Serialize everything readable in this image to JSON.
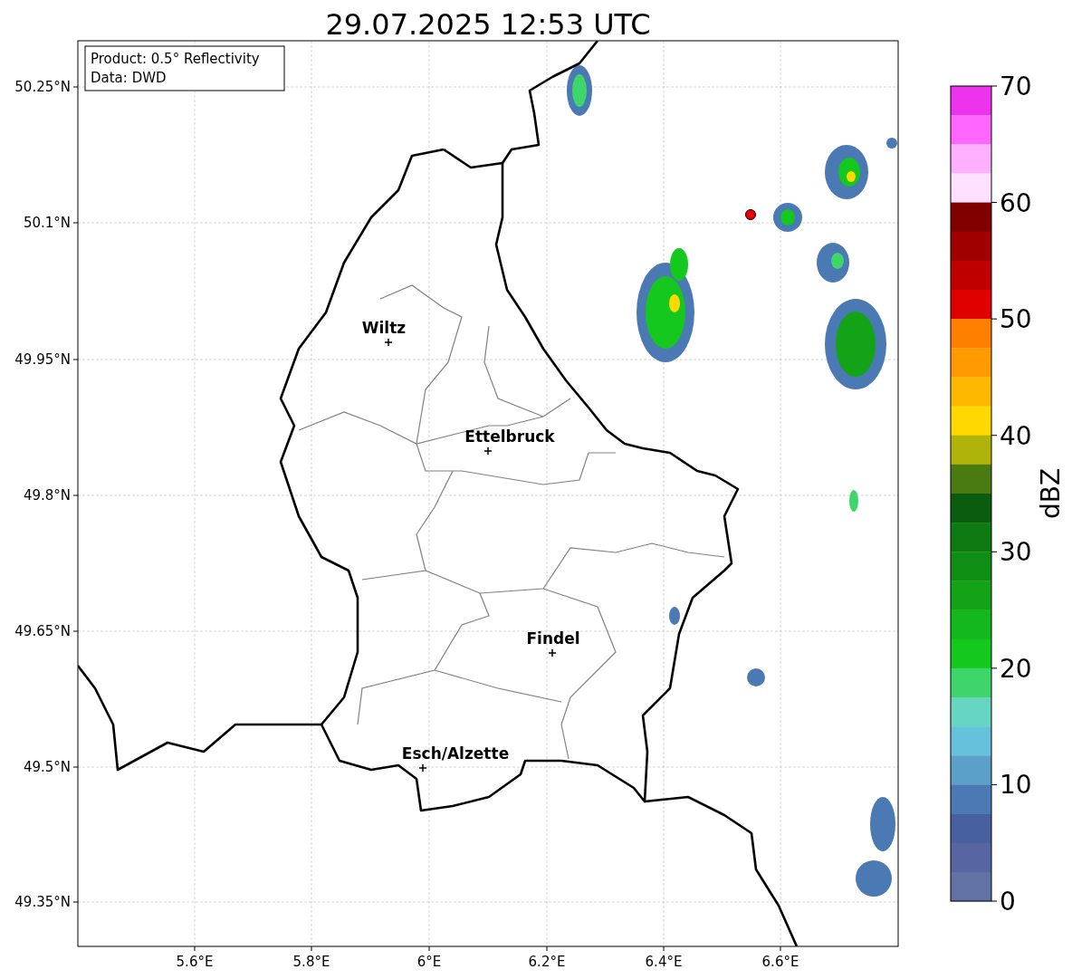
{
  "title": "29.07.2025 12:53 UTC",
  "info_box": {
    "lines": [
      "Product: 0.5° Reflectivity",
      "Data: DWD"
    ]
  },
  "map": {
    "lon_labels": [
      "5.6°E",
      "5.8°E",
      "6°E",
      "6.2°E",
      "6.4°E",
      "6.6°E"
    ],
    "lat_labels": [
      "50.25°N",
      "50.1°N",
      "49.95°N",
      "49.8°N",
      "49.65°N",
      "49.5°N",
      "49.35°N"
    ],
    "cities": [
      {
        "name": "Wiltz"
      },
      {
        "name": "Ettelbruck"
      },
      {
        "name": "Findel"
      },
      {
        "name": "Esch/Alzette"
      }
    ]
  },
  "colorbar": {
    "label": "dBZ",
    "ticks": [
      "70",
      "60",
      "50",
      "40",
      "30",
      "20",
      "10",
      "0"
    ],
    "segments": [
      {
        "color": "#ee33ee"
      },
      {
        "color": "#ff66ff"
      },
      {
        "color": "#ffb0ff"
      },
      {
        "color": "#ffe0ff"
      },
      {
        "color": "#800000"
      },
      {
        "color": "#a00000"
      },
      {
        "color": "#c00000"
      },
      {
        "color": "#e00000"
      },
      {
        "color": "#ff8000"
      },
      {
        "color": "#ff9a00"
      },
      {
        "color": "#ffb800"
      },
      {
        "color": "#ffd800"
      },
      {
        "color": "#b0b40a"
      },
      {
        "color": "#4a7a12"
      },
      {
        "color": "#0a5c0e"
      },
      {
        "color": "#0e7a12"
      },
      {
        "color": "#108e14"
      },
      {
        "color": "#12a416"
      },
      {
        "color": "#12b81c"
      },
      {
        "color": "#14c81e"
      },
      {
        "color": "#3ed66b"
      },
      {
        "color": "#66d6c2"
      },
      {
        "color": "#66c2dc"
      },
      {
        "color": "#5ba0c8"
      },
      {
        "color": "#4a79b3"
      },
      {
        "color": "#4660a0"
      },
      {
        "color": "#5766a2"
      },
      {
        "color": "#6272a4"
      }
    ]
  }
}
